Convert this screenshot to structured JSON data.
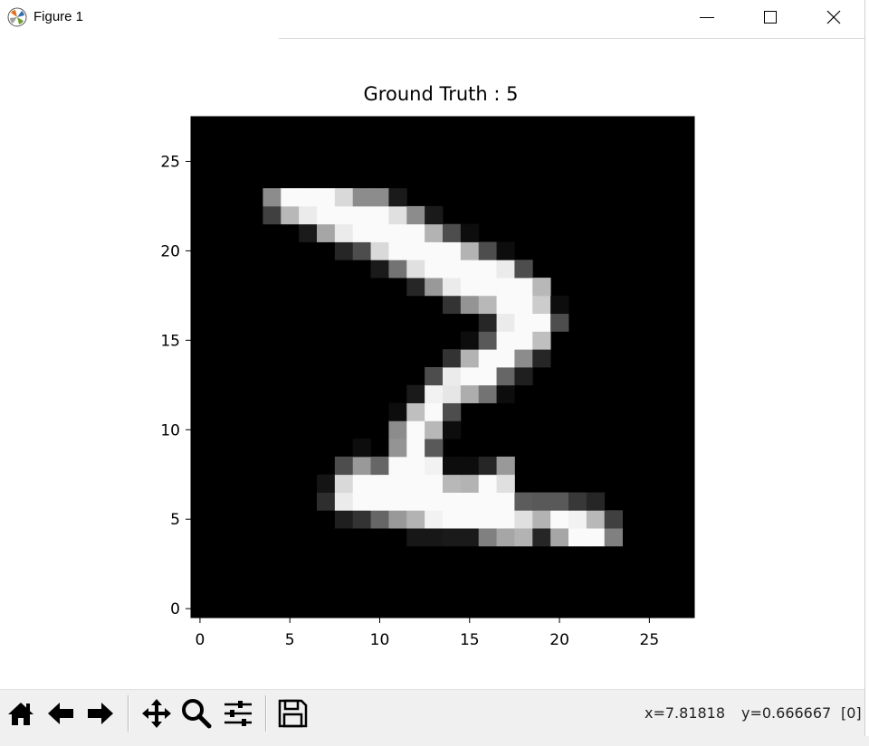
{
  "window": {
    "title": "Figure 1",
    "controls": [
      "minimize",
      "maximize",
      "close"
    ]
  },
  "figure": {
    "title": "Ground Truth : 5"
  },
  "chart_data": {
    "type": "heatmap",
    "title": "Ground Truth : 5",
    "xlabel": "",
    "ylabel": "",
    "xlim": [
      -0.5,
      27.5
    ],
    "ylim": [
      27.5,
      -0.5
    ],
    "xticks": [
      0,
      5,
      10,
      15,
      20,
      25
    ],
    "yticks": [
      0,
      5,
      10,
      15,
      20,
      25
    ],
    "colormap": "gray",
    "background": "#000000",
    "pixels": [
      [
        5,
        12,
        0.09
      ],
      [
        5,
        13,
        0.09
      ],
      [
        5,
        14,
        0.1
      ],
      [
        5,
        15,
        0.1
      ],
      [
        5,
        16,
        0.5
      ],
      [
        5,
        17,
        0.65
      ],
      [
        5,
        18,
        0.7
      ],
      [
        5,
        19,
        0.15
      ],
      [
        5,
        20,
        0.65
      ],
      [
        5,
        21,
        0.98
      ],
      [
        5,
        22,
        0.98
      ],
      [
        5,
        23,
        0.5
      ],
      [
        6,
        8,
        0.12
      ],
      [
        6,
        9,
        0.2
      ],
      [
        6,
        10,
        0.4
      ],
      [
        6,
        11,
        0.6
      ],
      [
        6,
        12,
        0.7
      ],
      [
        6,
        13,
        0.95
      ],
      [
        6,
        14,
        0.98
      ],
      [
        6,
        15,
        0.98
      ],
      [
        6,
        16,
        0.98
      ],
      [
        6,
        17,
        0.98
      ],
      [
        6,
        18,
        0.88
      ],
      [
        6,
        19,
        0.7
      ],
      [
        6,
        20,
        0.98
      ],
      [
        6,
        21,
        0.95
      ],
      [
        6,
        22,
        0.72
      ],
      [
        6,
        23,
        0.25
      ],
      [
        7,
        7,
        0.18
      ],
      [
        7,
        8,
        0.92
      ],
      [
        7,
        9,
        0.98
      ],
      [
        7,
        10,
        0.98
      ],
      [
        7,
        11,
        0.98
      ],
      [
        7,
        12,
        0.98
      ],
      [
        7,
        13,
        0.98
      ],
      [
        7,
        14,
        0.98
      ],
      [
        7,
        15,
        0.98
      ],
      [
        7,
        16,
        0.98
      ],
      [
        7,
        17,
        0.98
      ],
      [
        7,
        18,
        0.36
      ],
      [
        7,
        19,
        0.35
      ],
      [
        7,
        20,
        0.35
      ],
      [
        7,
        21,
        0.22
      ],
      [
        7,
        22,
        0.15
      ],
      [
        8,
        7,
        0.08
      ],
      [
        8,
        8,
        0.85
      ],
      [
        8,
        9,
        0.98
      ],
      [
        8,
        10,
        0.98
      ],
      [
        8,
        11,
        0.98
      ],
      [
        8,
        12,
        0.98
      ],
      [
        8,
        13,
        0.98
      ],
      [
        8,
        14,
        0.72
      ],
      [
        8,
        15,
        0.7
      ],
      [
        8,
        16,
        0.98
      ],
      [
        8,
        17,
        0.88
      ],
      [
        9,
        8,
        0.3
      ],
      [
        9,
        9,
        0.6
      ],
      [
        9,
        10,
        0.4
      ],
      [
        9,
        11,
        0.98
      ],
      [
        9,
        12,
        0.98
      ],
      [
        9,
        13,
        0.95
      ],
      [
        9,
        14,
        0.05
      ],
      [
        9,
        15,
        0.05
      ],
      [
        9,
        16,
        0.15
      ],
      [
        9,
        17,
        0.6
      ],
      [
        10,
        9,
        0.05
      ],
      [
        10,
        11,
        0.58
      ],
      [
        10,
        12,
        0.98
      ],
      [
        10,
        13,
        0.35
      ],
      [
        11,
        11,
        0.55
      ],
      [
        11,
        12,
        0.98
      ],
      [
        11,
        13,
        0.72
      ],
      [
        11,
        14,
        0.05
      ],
      [
        12,
        11,
        0.05
      ],
      [
        12,
        12,
        0.75
      ],
      [
        12,
        13,
        0.98
      ],
      [
        12,
        14,
        0.3
      ],
      [
        13,
        12,
        0.1
      ],
      [
        13,
        13,
        0.95
      ],
      [
        13,
        14,
        0.9
      ],
      [
        13,
        15,
        0.68
      ],
      [
        13,
        16,
        0.45
      ],
      [
        13,
        17,
        0.05
      ],
      [
        14,
        13,
        0.3
      ],
      [
        14,
        14,
        0.92
      ],
      [
        14,
        15,
        0.98
      ],
      [
        14,
        16,
        0.98
      ],
      [
        14,
        17,
        0.4
      ],
      [
        14,
        18,
        0.12
      ],
      [
        15,
        14,
        0.2
      ],
      [
        15,
        15,
        0.7
      ],
      [
        15,
        16,
        0.98
      ],
      [
        15,
        17,
        0.98
      ],
      [
        15,
        18,
        0.55
      ],
      [
        15,
        19,
        0.15
      ],
      [
        16,
        15,
        0.05
      ],
      [
        16,
        16,
        0.35
      ],
      [
        16,
        17,
        0.98
      ],
      [
        16,
        18,
        0.98
      ],
      [
        16,
        19,
        0.75
      ],
      [
        17,
        16,
        0.15
      ],
      [
        17,
        17,
        0.92
      ],
      [
        17,
        18,
        0.98
      ],
      [
        17,
        19,
        0.98
      ],
      [
        17,
        20,
        0.3
      ],
      [
        18,
        14,
        0.2
      ],
      [
        18,
        15,
        0.58
      ],
      [
        18,
        16,
        0.72
      ],
      [
        18,
        17,
        0.98
      ],
      [
        18,
        18,
        0.98
      ],
      [
        18,
        19,
        0.8
      ],
      [
        18,
        20,
        0.05
      ],
      [
        19,
        12,
        0.15
      ],
      [
        19,
        13,
        0.6
      ],
      [
        19,
        14,
        0.92
      ],
      [
        19,
        15,
        0.98
      ],
      [
        19,
        16,
        0.98
      ],
      [
        19,
        17,
        0.98
      ],
      [
        19,
        18,
        0.98
      ],
      [
        19,
        19,
        0.72
      ],
      [
        20,
        10,
        0.1
      ],
      [
        20,
        11,
        0.45
      ],
      [
        20,
        12,
        0.88
      ],
      [
        20,
        13,
        0.98
      ],
      [
        20,
        14,
        0.98
      ],
      [
        20,
        15,
        0.98
      ],
      [
        20,
        16,
        0.98
      ],
      [
        20,
        17,
        0.92
      ],
      [
        20,
        18,
        0.3
      ],
      [
        21,
        8,
        0.15
      ],
      [
        21,
        9,
        0.3
      ],
      [
        21,
        10,
        0.85
      ],
      [
        21,
        11,
        0.98
      ],
      [
        21,
        12,
        0.98
      ],
      [
        21,
        13,
        0.98
      ],
      [
        21,
        14,
        0.98
      ],
      [
        21,
        15,
        0.7
      ],
      [
        21,
        16,
        0.3
      ],
      [
        21,
        17,
        0.05
      ],
      [
        22,
        6,
        0.1
      ],
      [
        22,
        7,
        0.65
      ],
      [
        22,
        8,
        0.92
      ],
      [
        22,
        9,
        0.98
      ],
      [
        22,
        10,
        0.98
      ],
      [
        22,
        11,
        0.98
      ],
      [
        22,
        12,
        0.98
      ],
      [
        22,
        13,
        0.7
      ],
      [
        22,
        14,
        0.3
      ],
      [
        22,
        15,
        0.05
      ],
      [
        23,
        4,
        0.25
      ],
      [
        23,
        5,
        0.72
      ],
      [
        23,
        6,
        0.92
      ],
      [
        23,
        7,
        0.98
      ],
      [
        23,
        8,
        0.98
      ],
      [
        23,
        9,
        0.98
      ],
      [
        23,
        10,
        0.98
      ],
      [
        23,
        11,
        0.88
      ],
      [
        23,
        12,
        0.55
      ],
      [
        23,
        13,
        0.1
      ],
      [
        24,
        4,
        0.55
      ],
      [
        24,
        5,
        0.98
      ],
      [
        24,
        6,
        0.98
      ],
      [
        24,
        7,
        0.98
      ],
      [
        24,
        8,
        0.85
      ],
      [
        24,
        9,
        0.55
      ],
      [
        24,
        10,
        0.55
      ],
      [
        24,
        11,
        0.1
      ]
    ]
  },
  "toolbar": {
    "buttons": [
      {
        "name": "home-button",
        "icon": "home-icon"
      },
      {
        "name": "back-button",
        "icon": "arrow-left-icon"
      },
      {
        "name": "forward-button",
        "icon": "arrow-right-icon"
      },
      {
        "name": "pan-button",
        "icon": "move-icon"
      },
      {
        "name": "zoom-button",
        "icon": "magnifier-icon"
      },
      {
        "name": "configure-subplots-button",
        "icon": "sliders-icon"
      },
      {
        "name": "save-button",
        "icon": "floppy-disk-icon"
      }
    ],
    "status": {
      "x": "x=7.81818",
      "y": "y=0.666667",
      "value": "[0]"
    }
  }
}
